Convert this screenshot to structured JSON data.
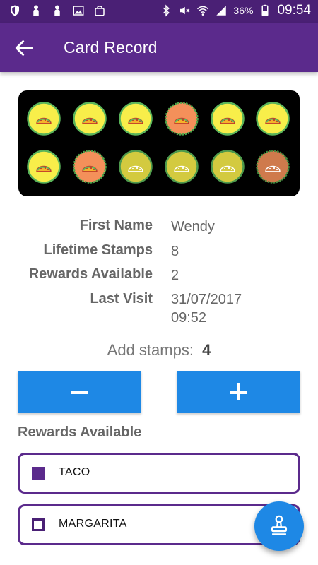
{
  "status_bar": {
    "battery": "36%",
    "time": "09:54",
    "icons_left": [
      "shield-icon",
      "person-icon",
      "person-icon",
      "image-icon",
      "bag-icon"
    ],
    "icons_right": [
      "bluetooth-icon",
      "mute-icon",
      "wifi-icon",
      "signal-icon",
      "battery-icon"
    ]
  },
  "app_bar": {
    "title": "Card Record",
    "back_icon": "back-arrow-icon"
  },
  "stamp_card": {
    "colors": {
      "yellow": "#f8ee4a",
      "orange": "#f4905a",
      "green_ring": "#5ab45a"
    },
    "stamps": [
      {
        "state": "stamped",
        "color": "yellow"
      },
      {
        "state": "stamped",
        "color": "yellow"
      },
      {
        "state": "stamped",
        "color": "yellow"
      },
      {
        "state": "stamped",
        "color": "orange"
      },
      {
        "state": "stamped",
        "color": "yellow"
      },
      {
        "state": "stamped",
        "color": "yellow"
      },
      {
        "state": "stamped",
        "color": "yellow"
      },
      {
        "state": "stamped",
        "color": "orange"
      },
      {
        "state": "empty",
        "color": "yellow"
      },
      {
        "state": "empty",
        "color": "yellow"
      },
      {
        "state": "empty",
        "color": "yellow"
      },
      {
        "state": "empty",
        "color": "orange"
      }
    ]
  },
  "details": [
    {
      "label": "First  Name",
      "value": "Wendy"
    },
    {
      "label": "Lifetime Stamps",
      "value": "8"
    },
    {
      "label": "Rewards Available",
      "value": "2"
    },
    {
      "label": "Last Visit",
      "value": "31/07/2017\n09:52"
    }
  ],
  "add_stamps": {
    "label": "Add stamps:",
    "value": "4"
  },
  "buttons": {
    "decrement_icon": "minus-icon",
    "increment_icon": "plus-icon"
  },
  "rewards": {
    "title": "Rewards Available",
    "items": [
      {
        "label": "TACO",
        "checked": true
      },
      {
        "label": "MARGARITA",
        "checked": false
      }
    ]
  },
  "fab": {
    "icon": "stamp-icon"
  },
  "theme": {
    "primary": "#5b2a8c",
    "primary_dark": "#4a2075",
    "accent": "#1e88e5"
  }
}
